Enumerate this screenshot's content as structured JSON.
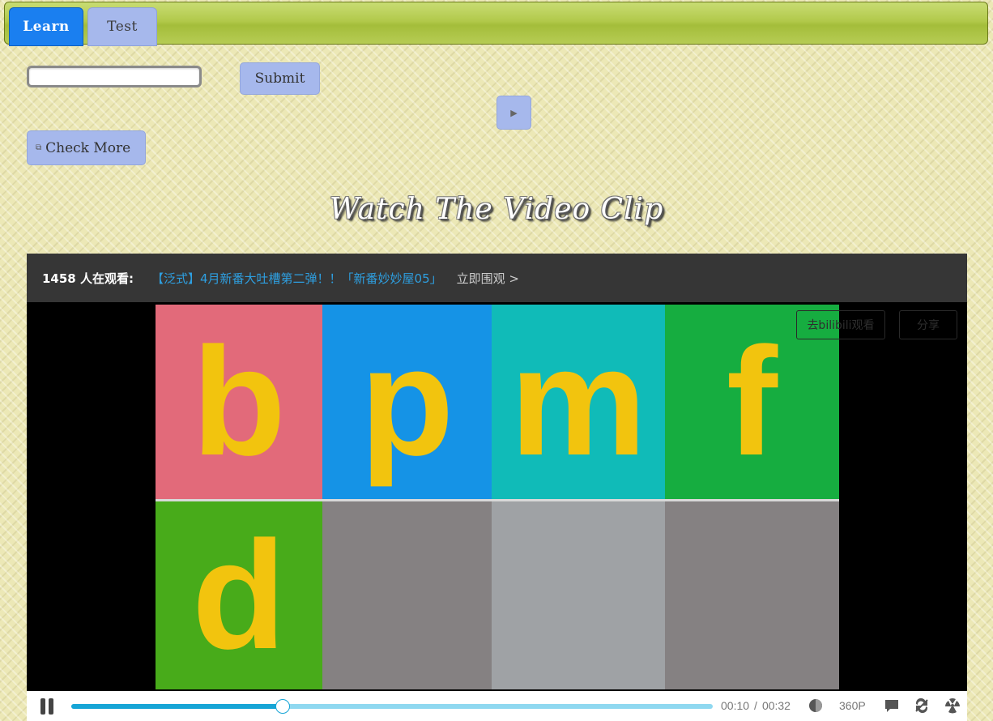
{
  "tabs": [
    {
      "label": "Learn",
      "active": true
    },
    {
      "label": "Test",
      "active": false
    }
  ],
  "form": {
    "input_value": "",
    "input_placeholder": "",
    "submit_label": "Submit",
    "play_icon": "▶"
  },
  "check_more": {
    "icon": "⧉",
    "label": "Check More"
  },
  "section_title": "Watch The Video Clip",
  "player": {
    "viewers": "1458 人在观看:",
    "promo_text": "【泛式】4月新番大吐槽第二弹！！「新番妙妙屋05」",
    "watch_link": "立即围观 >",
    "open_bilibili": "去bilibili观看",
    "share": "分享",
    "letters": [
      "b",
      "p",
      "m",
      "f",
      "d"
    ],
    "current_time": "00:10",
    "time_separator": "/",
    "duration": "00:32",
    "progress": 0.33,
    "quality": "360P"
  },
  "colors": {
    "tab_active": "#1a7ff0",
    "button_blue": "#a6b8ec",
    "progress_fill": "#17a5d6",
    "promo_link": "#2e9fe0",
    "letter_yellow": "#f2c40e"
  }
}
